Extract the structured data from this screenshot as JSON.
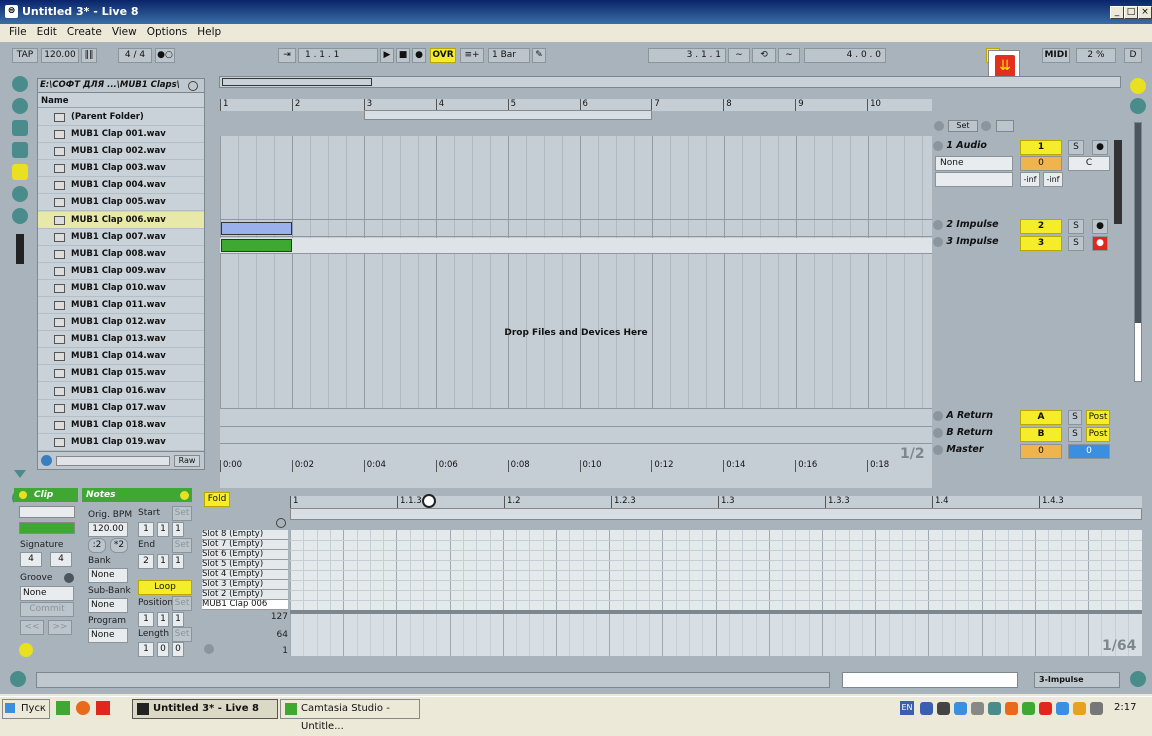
{
  "window": {
    "title": "Untitled 3* - Live 8"
  },
  "menu": [
    "File",
    "Edit",
    "Create",
    "View",
    "Options",
    "Help"
  ],
  "transport": {
    "tap": "TAP",
    "tempo": "120.00",
    "signature": "4 / 4",
    "position": "1 .   1 .   1",
    "ovr": "OVR",
    "quantize": "1 Bar",
    "loop_start": "3 .   1 .   1",
    "loop_length": "4 .   0 .   0",
    "key": "KEY",
    "midi": "MIDI",
    "cpu": "2 %",
    "d": "D"
  },
  "browser": {
    "path": "E:\\СОФТ ДЛЯ ...\\MUB1 Claps\\",
    "column": "Name",
    "parent": "(Parent Folder)",
    "files": [
      "MUB1 Clap 001.wav",
      "MUB1 Clap 002.wav",
      "MUB1 Clap 003.wav",
      "MUB1 Clap 004.wav",
      "MUB1 Clap 005.wav",
      "MUB1 Clap 006.wav",
      "MUB1 Clap 007.wav",
      "MUB1 Clap 008.wav",
      "MUB1 Clap 009.wav",
      "MUB1 Clap 010.wav",
      "MUB1 Clap 011.wav",
      "MUB1 Clap 012.wav",
      "MUB1 Clap 013.wav",
      "MUB1 Clap 014.wav",
      "MUB1 Clap 015.wav",
      "MUB1 Clap 016.wav",
      "MUB1 Clap 017.wav",
      "MUB1 Clap 018.wav",
      "MUB1 Clap 019.wav"
    ],
    "selected_index": 5,
    "raw": "Raw"
  },
  "arrangement": {
    "bars": [
      "1",
      "2",
      "3",
      "4",
      "5",
      "6",
      "7",
      "8",
      "9",
      "10"
    ],
    "times": [
      "0:00",
      "0:02",
      "0:04",
      "0:06",
      "0:08",
      "0:10",
      "0:12",
      "0:14",
      "0:16",
      "0:18"
    ],
    "drop_text": "Drop Files and Devices Here",
    "page": "1/2",
    "set": "Set"
  },
  "tracks": [
    {
      "name": "1 Audio",
      "num": "1",
      "s": "S",
      "io": "None",
      "vol": "0",
      "pan": "C",
      "inf1": "-inf",
      "inf2": "-inf"
    },
    {
      "name": "2 Impulse",
      "num": "2",
      "s": "S"
    },
    {
      "name": "3 Impulse",
      "num": "3",
      "s": "S"
    },
    {
      "name": "A Return",
      "num": "A",
      "s": "S",
      "post": "Post"
    },
    {
      "name": "B Return",
      "num": "B",
      "s": "S",
      "post": "Post"
    },
    {
      "name": "Master",
      "num": "0",
      "vol2": "0"
    }
  ],
  "clip": {
    "clip_title": "Clip",
    "notes_title": "Notes",
    "signature_label": "Signature",
    "sig_num": "4",
    "sig_den": "4",
    "groove_label": "Groove",
    "groove_val": "None",
    "commit": "Commit",
    "orig_bpm_label": "Orig. BPM",
    "orig_bpm": "120.00",
    "half": ":2",
    "double": "*2",
    "bank_label": "Bank",
    "bank_val": "None",
    "subbank_label": "Sub-Bank",
    "subbank_val": "None",
    "program_label": "Program",
    "program_val": "None",
    "start_label": "Start",
    "end_label": "End",
    "loop": "Loop",
    "position_label": "Position",
    "length_label": "Length",
    "set": "Set",
    "start_vals": [
      "1",
      "1",
      "1"
    ],
    "end_vals": [
      "2",
      "1",
      "1"
    ],
    "pos_vals": [
      "1",
      "1",
      "1"
    ],
    "len_vals": [
      "1",
      "0",
      "0"
    ],
    "fold": "Fold",
    "ruler": [
      "1",
      "1.1.3",
      "1.2",
      "1.2.3",
      "1.3",
      "1.3.3",
      "1.4",
      "1.4.3"
    ],
    "slots": [
      "Slot 8 (Empty)",
      "Slot 7 (Empty)",
      "Slot 6 (Empty)",
      "Slot 5 (Empty)",
      "Slot 4 (Empty)",
      "Slot 3 (Empty)",
      "Slot 2 (Empty)",
      "MUB1 Clap 006"
    ],
    "vel": [
      "127",
      "64",
      "1"
    ],
    "zoom": "1/64"
  },
  "status": {
    "track": "3-Impulse"
  },
  "taskbar": {
    "start": "Пуск",
    "tasks": [
      "Untitled 3* - Live 8",
      "Camtasia Studio - Untitle..."
    ],
    "lang": "EN",
    "clock": "2:17"
  }
}
